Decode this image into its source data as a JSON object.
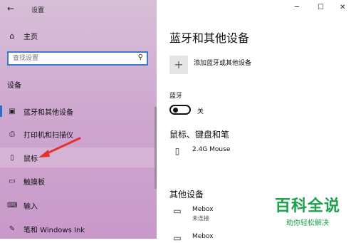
{
  "window": {
    "title": "设置",
    "back_glyph": "←",
    "min_glyph": "─",
    "max_glyph": "☐",
    "close_glyph": "✕"
  },
  "sidebar": {
    "home_label": "主页",
    "search_placeholder": "查找设置",
    "section_label": "设备",
    "items": [
      {
        "label": "蓝牙和其他设备",
        "icon": "bluetooth-devices-icon",
        "glyph": "▣"
      },
      {
        "label": "打印机和扫描仪",
        "icon": "printer-icon",
        "glyph": "⎙"
      },
      {
        "label": "鼠标",
        "icon": "mouse-icon",
        "glyph": "▯"
      },
      {
        "label": "触摸板",
        "icon": "touchpad-icon",
        "glyph": "▭"
      },
      {
        "label": "输入",
        "icon": "keyboard-icon",
        "glyph": "⌨"
      },
      {
        "label": "笔和 Windows Ink",
        "icon": "pen-icon",
        "glyph": "✎"
      }
    ]
  },
  "main": {
    "title": "蓝牙和其他设备",
    "add_device_label": "添加蓝牙或其他设备",
    "bluetooth_label": "蓝牙",
    "bluetooth_state": "关",
    "bluetooth_on": false,
    "mouse_section": "鼠标、键盘和笔",
    "mouse_devices": [
      {
        "name": "2.4G Mouse",
        "status": ""
      }
    ],
    "other_section": "其他设备",
    "other_devices": [
      {
        "name": "Mebox",
        "status": "未连接"
      },
      {
        "name": "Mebox",
        "status": ""
      }
    ]
  },
  "watermark": {
    "title": "百科全说",
    "subtitle": "助你轻松解决"
  },
  "colors": {
    "accent": "#2d6fc4",
    "annotation_arrow": "#e0332f",
    "watermark_green": "#1aa34a"
  }
}
